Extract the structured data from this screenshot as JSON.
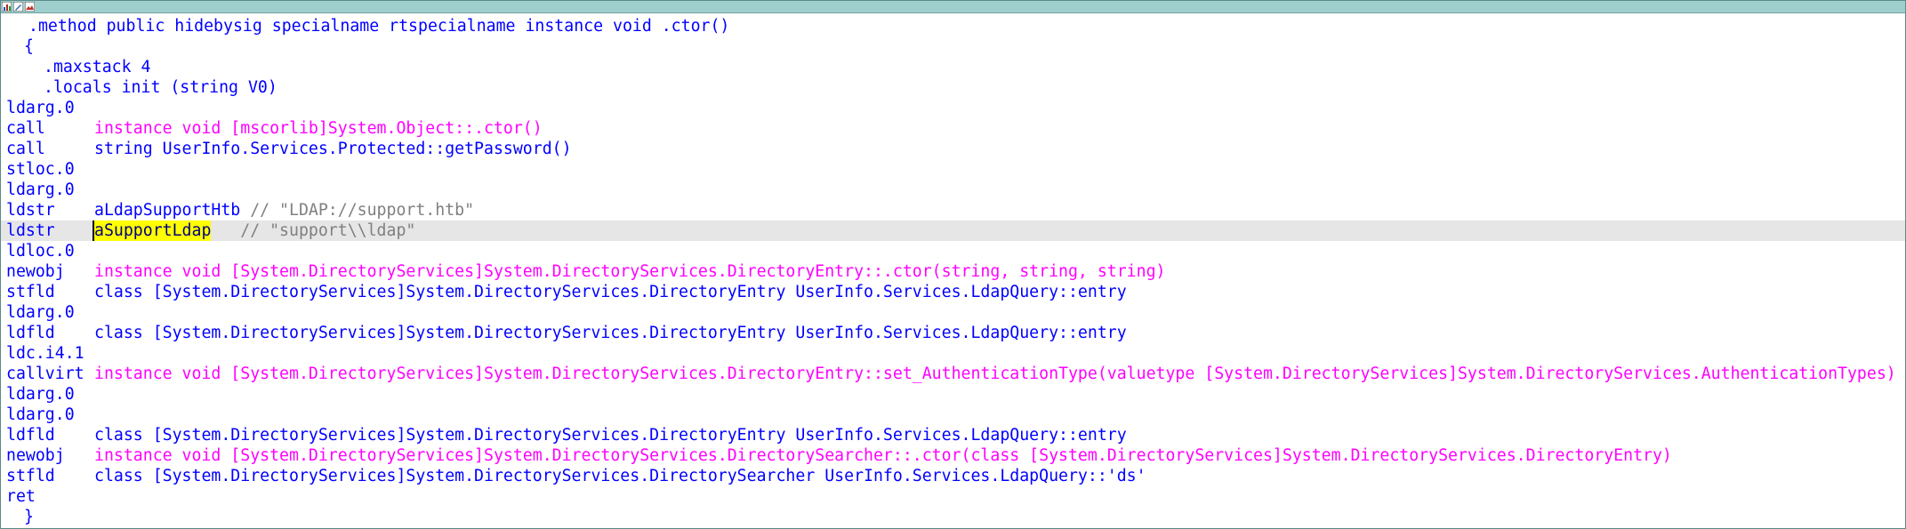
{
  "titlebar": {
    "icons": [
      "graph-icon",
      "edit-icon",
      "image-icon"
    ]
  },
  "code": {
    "lines": {
      "l01": ".method public hidebysig specialname rtspecialname instance void .ctor()",
      "l02": "{",
      "l03": ".maxstack 4",
      "l04": ".locals init (string V0)",
      "l05": "ldarg.0",
      "l06_op": "call",
      "l06_arg": "instance void [mscorlib]System.Object::.ctor()",
      "l07_op": "call",
      "l07_arg": "string UserInfo.Services.Protected::getPassword()",
      "l08": "stloc.0",
      "l09": "ldarg.0",
      "l10_op": "ldstr",
      "l10_ref": "aLdapSupportHtb",
      "l10_comment": " // \"LDAP://support.htb\"",
      "l11_op": "ldstr",
      "l11_ref": "aSupportLdap",
      "l11_comment": "   // \"support\\\\ldap\"",
      "l12": "ldloc.0",
      "l13_op": "newobj",
      "l13_arg": "instance void [System.DirectoryServices]System.DirectoryServices.DirectoryEntry::.ctor(string, string, string)",
      "l14_op": "stfld",
      "l14_arg": "class [System.DirectoryServices]System.DirectoryServices.DirectoryEntry UserInfo.Services.LdapQuery::entry",
      "l15": "ldarg.0",
      "l16_op": "ldfld",
      "l16_arg": "class [System.DirectoryServices]System.DirectoryServices.DirectoryEntry UserInfo.Services.LdapQuery::entry",
      "l17": "ldc.i4.1",
      "l18_op": "callvirt",
      "l18_arg": "instance void [System.DirectoryServices]System.DirectoryServices.DirectoryEntry::set_AuthenticationType(valuetype [System.DirectoryServices]System.DirectoryServices.AuthenticationTypes)",
      "l19": "ldarg.0",
      "l20": "ldarg.0",
      "l21_op": "ldfld",
      "l21_arg": "class [System.DirectoryServices]System.DirectoryServices.DirectoryEntry UserInfo.Services.LdapQuery::entry",
      "l22_op": "newobj",
      "l22_arg": "instance void [System.DirectoryServices]System.DirectoryServices.DirectorySearcher::.ctor(class [System.DirectoryServices]System.DirectoryServices.DirectoryEntry)",
      "l23_op": "stfld",
      "l23_arg": "class [System.DirectoryServices]System.DirectoryServices.DirectorySearcher UserInfo.Services.LdapQuery::'ds'",
      "l24": "ret",
      "l25": "}"
    }
  },
  "colors": {
    "instruction": "#0000ff",
    "method_ref": "#ff00ff",
    "field_ref": "#0000ff",
    "comment": "#808080",
    "selection": "#ffff00",
    "current_line": "#e6e6e6",
    "titlebar": "#9fcfcc"
  }
}
